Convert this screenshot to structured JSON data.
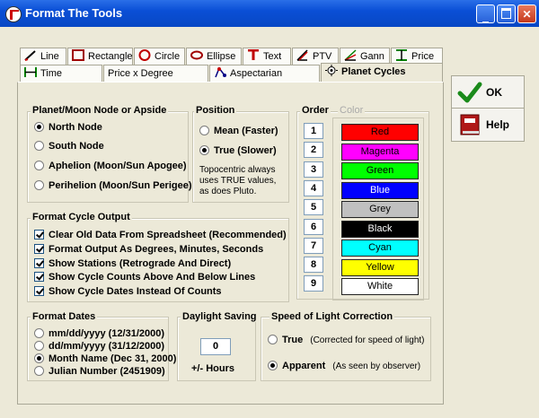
{
  "window": {
    "title": "Format The Tools"
  },
  "tabs_row1": [
    {
      "label": "Line",
      "icon": "line-tool-icon",
      "color": "#0000c0"
    },
    {
      "label": "Rectangle",
      "icon": "rectangle-tool-icon",
      "color": "#a00000"
    },
    {
      "label": "Circle",
      "icon": "circle-tool-icon",
      "color": "#c00000"
    },
    {
      "label": "Ellipse",
      "icon": "ellipse-tool-icon",
      "color": "#a00000"
    },
    {
      "label": "Text",
      "icon": "text-tool-icon",
      "color": "#c00000"
    },
    {
      "label": "PTV",
      "icon": "ptv-tool-icon",
      "color": "#c00000"
    },
    {
      "label": "Gann",
      "icon": "gann-tool-icon",
      "color": "#008000"
    },
    {
      "label": "Price",
      "icon": "price-tool-icon",
      "color": "#008000"
    }
  ],
  "tabs_row2": [
    {
      "label": "Time",
      "icon": "time-tool-icon"
    },
    {
      "label": "Price x Degree",
      "icon": ""
    },
    {
      "label": "Aspectarian",
      "icon": "aspectarian-icon"
    },
    {
      "label": "Planet Cycles",
      "icon": "planet-cycles-icon",
      "active": true
    }
  ],
  "planet": {
    "title": "Planet/Moon  Node or Apside",
    "options": [
      "North Node",
      "South Node",
      "Aphelion (Moon/Sun Apogee)",
      "Perihelion (Moon/Sun Perigee)"
    ],
    "selected": 0
  },
  "position": {
    "title": "Position",
    "options": [
      "Mean (Faster)",
      "True (Slower)"
    ],
    "selected": 1,
    "note": "Topocentric always uses TRUE values, as does Pluto."
  },
  "order": {
    "title": "Order",
    "values": [
      "1",
      "2",
      "3",
      "4",
      "5",
      "6",
      "7",
      "8",
      "9"
    ]
  },
  "color": {
    "title": "Color",
    "items": [
      {
        "name": "Red",
        "bg": "#ff0000",
        "fg": "#000000"
      },
      {
        "name": "Magenta",
        "bg": "#ff00ff",
        "fg": "#000000"
      },
      {
        "name": "Green",
        "bg": "#00ff00",
        "fg": "#000000"
      },
      {
        "name": "Blue",
        "bg": "#0000ff",
        "fg": "#ffffff"
      },
      {
        "name": "Grey",
        "bg": "#c0c0c0",
        "fg": "#000000"
      },
      {
        "name": "Black",
        "bg": "#000000",
        "fg": "#ffffff"
      },
      {
        "name": "Cyan",
        "bg": "#00ffff",
        "fg": "#000000"
      },
      {
        "name": "Yellow",
        "bg": "#ffff00",
        "fg": "#000000"
      },
      {
        "name": "White",
        "bg": "#ffffff",
        "fg": "#000000"
      }
    ]
  },
  "output": {
    "title": "Format Cycle Output",
    "options": [
      "Clear Old Data From Spreadsheet (Recommended)",
      "Format Output As Degrees, Minutes, Seconds",
      "Show Stations (Retrograde And Direct)",
      "Show Cycle Counts Above And Below Lines",
      "Show Cycle Dates Instead Of Counts"
    ],
    "checked": [
      true,
      true,
      true,
      true,
      true
    ]
  },
  "dates": {
    "title": "Format Dates",
    "options": [
      "mm/dd/yyyy (12/31/2000)",
      "dd/mm/yyyy (31/12/2000)",
      "Month Name (Dec 31, 2000)",
      "Julian Number (2451909)"
    ],
    "selected": 2
  },
  "daylight": {
    "title": "Daylight Saving",
    "value": "0",
    "label": "+/-  Hours"
  },
  "sol": {
    "title": "Speed of Light Correction",
    "options": [
      {
        "label": "True",
        "desc": "(Corrected for speed of light)"
      },
      {
        "label": "Apparent",
        "desc": "(As seen by observer)"
      }
    ],
    "selected": 1
  },
  "buttons": {
    "ok": "OK",
    "help": "Help"
  }
}
